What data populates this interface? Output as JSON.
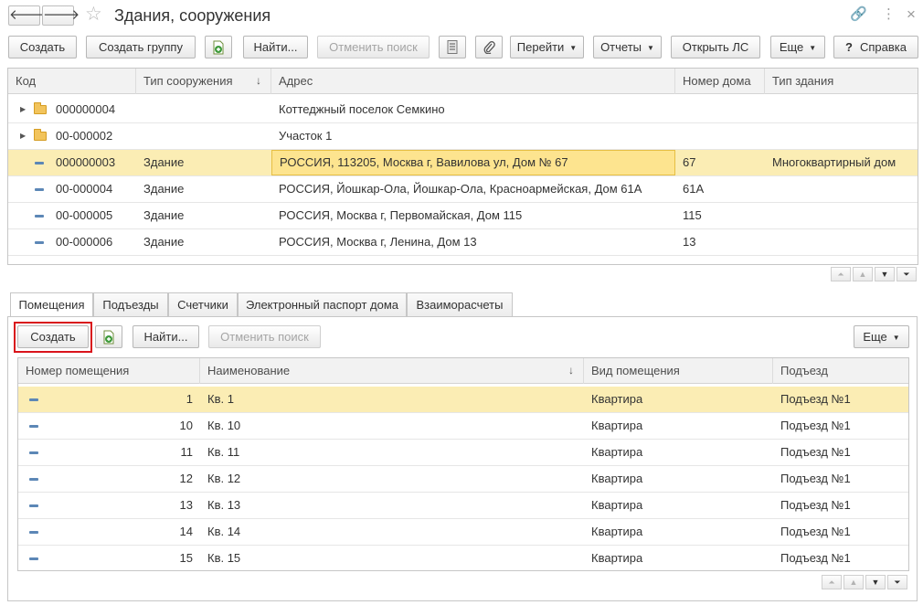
{
  "window": {
    "title": "Здания, сооружения",
    "back_icon": "arrow-left-icon",
    "forward_icon": "arrow-right-icon",
    "favorite_icon": "star-icon",
    "link_icon": "link-icon",
    "menu_icon": "more-vert-icon",
    "close_icon": "close-icon",
    "back_glyph": "🡐",
    "forward_glyph": "🡒",
    "star_glyph": "☆",
    "link_glyph": "🔗",
    "menu_glyph": "⋮",
    "close_glyph": "×"
  },
  "toolbar": {
    "create": "Создать",
    "create_group": "Создать группу",
    "find": "Найти...",
    "cancel_search": "Отменить поиск",
    "go": "Перейти",
    "reports": "Отчеты",
    "open_ls": "Открыть ЛС",
    "more": "Еще",
    "help": "Справка",
    "help_q": "?"
  },
  "buildings": {
    "columns": [
      "Код",
      "Тип сооружения",
      "Адрес",
      "Номер дома",
      "Тип здания"
    ],
    "sort_indicator": "↓",
    "rows": [
      {
        "code": "000000004",
        "type": "",
        "address": "Коттеджный поселок Семкино",
        "house": "",
        "building_type": ""
      },
      {
        "code": "00-000002",
        "type": "",
        "address": "Участок 1",
        "house": "",
        "building_type": ""
      },
      {
        "code": "000000003",
        "type": "Здание",
        "address": "РОССИЯ, 113205, Москва г, Вавилова ул, Дом № 67",
        "house": "67",
        "building_type": "Многоквартирный дом"
      },
      {
        "code": "00-000004",
        "type": "Здание",
        "address": "РОССИЯ, Йошкар-Ола, Йошкар-Ола, Красноармейская, Дом 61А",
        "house": "61А",
        "building_type": ""
      },
      {
        "code": "00-000005",
        "type": "Здание",
        "address": "РОССИЯ, Москва г, Первомайская, Дом 115",
        "house": "115",
        "building_type": ""
      },
      {
        "code": "00-000006",
        "type": "Здание",
        "address": "РОССИЯ, Москва г, Ленина, Дом 13",
        "house": "13",
        "building_type": ""
      }
    ]
  },
  "tabs": [
    "Помещения",
    "Подъезды",
    "Счетчики",
    "Электронный паспорт дома",
    "Взаиморасчеты"
  ],
  "sub_toolbar": {
    "create": "Создать",
    "find": "Найти...",
    "cancel_search": "Отменить поиск",
    "more": "Еще"
  },
  "rooms": {
    "columns": [
      "Номер помещения",
      "Наименование",
      "Вид помещения",
      "Подъезд"
    ],
    "sort_indicator": "↓",
    "rows": [
      {
        "num": "1",
        "name": "Кв. 1",
        "kind": "Квартира",
        "entrance": "Подъезд №1"
      },
      {
        "num": "10",
        "name": "Кв. 10",
        "kind": "Квартира",
        "entrance": "Подъезд №1"
      },
      {
        "num": "11",
        "name": "Кв. 11",
        "kind": "Квартира",
        "entrance": "Подъезд №1"
      },
      {
        "num": "12",
        "name": "Кв. 12",
        "kind": "Квартира",
        "entrance": "Подъезд №1"
      },
      {
        "num": "13",
        "name": "Кв. 13",
        "kind": "Квартира",
        "entrance": "Подъезд №1"
      },
      {
        "num": "14",
        "name": "Кв. 14",
        "kind": "Квартира",
        "entrance": "Подъезд №1"
      },
      {
        "num": "15",
        "name": "Кв. 15",
        "kind": "Квартира",
        "entrance": "Подъезд №1"
      }
    ]
  },
  "scroll_glyphs": {
    "top": "⏶",
    "up": "▲",
    "down": "▼",
    "bottom": "⏷"
  }
}
